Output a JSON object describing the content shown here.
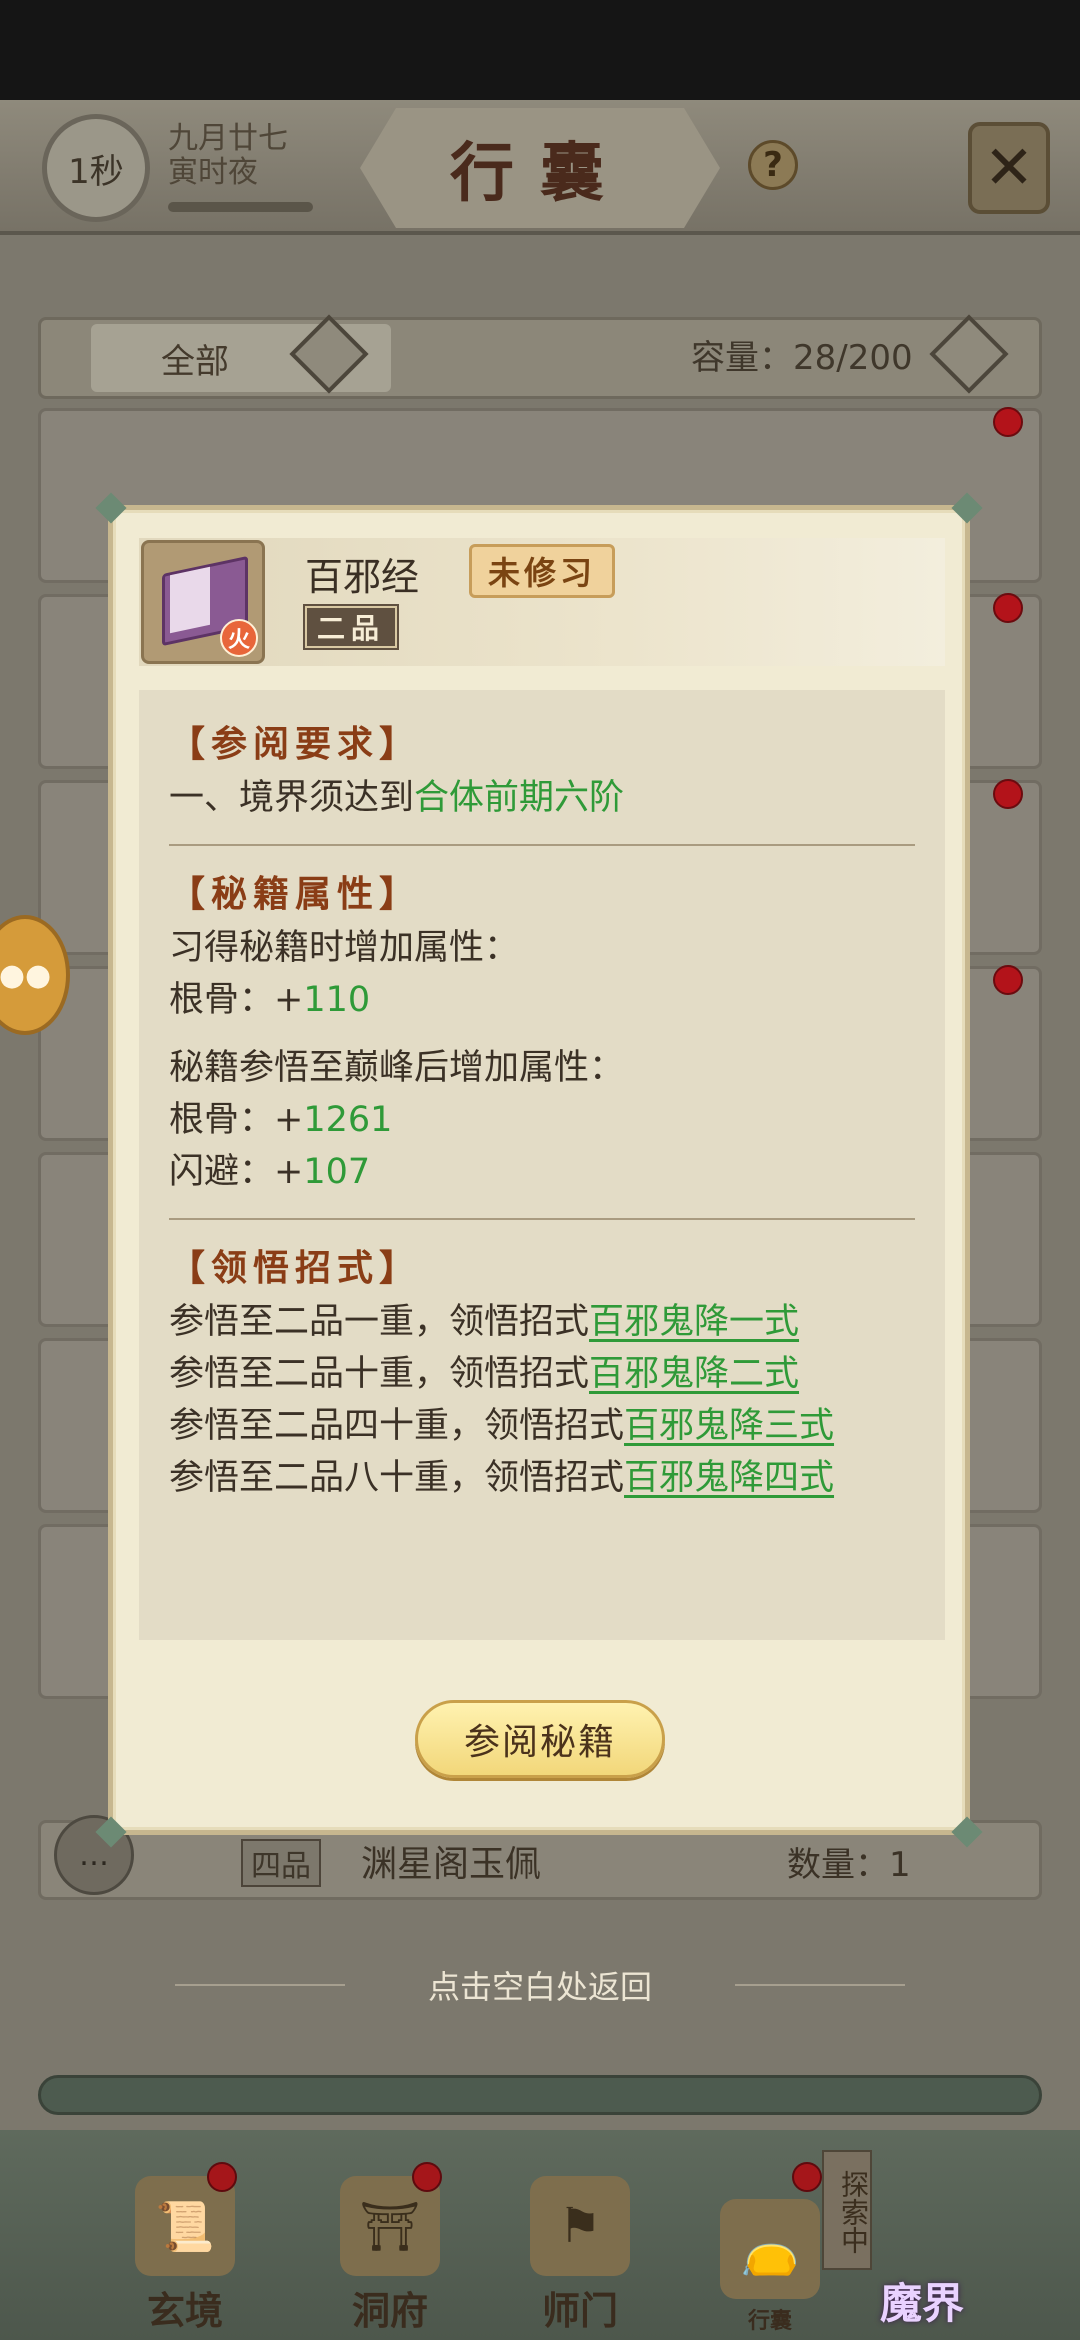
{
  "header": {
    "timer": "1秒",
    "date_line1": "九月廿七",
    "date_line2": "寅时夜",
    "title": "行囊",
    "help": "?",
    "close": "✕"
  },
  "filter": {
    "selected": "全部",
    "capacity_label": "容量：28/200"
  },
  "background_last_item": {
    "grade": "四品",
    "name": "渊星阁玉佩",
    "quantity": "数量：1"
  },
  "back_hint": "点击空白处返回",
  "nav": [
    {
      "label": "玄境"
    },
    {
      "label": "洞府"
    },
    {
      "label": "师门"
    },
    {
      "label": "行囊"
    }
  ],
  "explore_tag": "探索中",
  "demon_label": "魔界",
  "modal": {
    "item_name": "百邪经",
    "status": "未修习",
    "grade": "二品",
    "element_badge": "火",
    "sections": {
      "req_title": "【参阅要求】",
      "req_line_prefix": "一、境界须达到",
      "req_line_value": "合体前期六阶",
      "attr_title": "【秘籍属性】",
      "learn_label": "习得秘籍时增加属性：",
      "learn_stat_label": "根骨：+",
      "learn_stat_value": "110",
      "peak_label": "秘籍参悟至巅峰后增加属性：",
      "peak_stat1_label": "根骨：+",
      "peak_stat1_value": "1261",
      "peak_stat2_label": "闪避：+",
      "peak_stat2_value": "107",
      "skill_title": "【领悟招式】",
      "skills": [
        {
          "prefix": "参悟至二品一重，领悟招式",
          "skill": "百邪鬼降一式"
        },
        {
          "prefix": "参悟至二品十重，领悟招式",
          "skill": "百邪鬼降二式"
        },
        {
          "prefix": "参悟至二品四十重，领悟招式",
          "skill": "百邪鬼降三式"
        },
        {
          "prefix": "参悟至二品八十重，领悟招式",
          "skill": "百邪鬼降四式"
        }
      ]
    },
    "action_button": "参阅秘籍"
  }
}
